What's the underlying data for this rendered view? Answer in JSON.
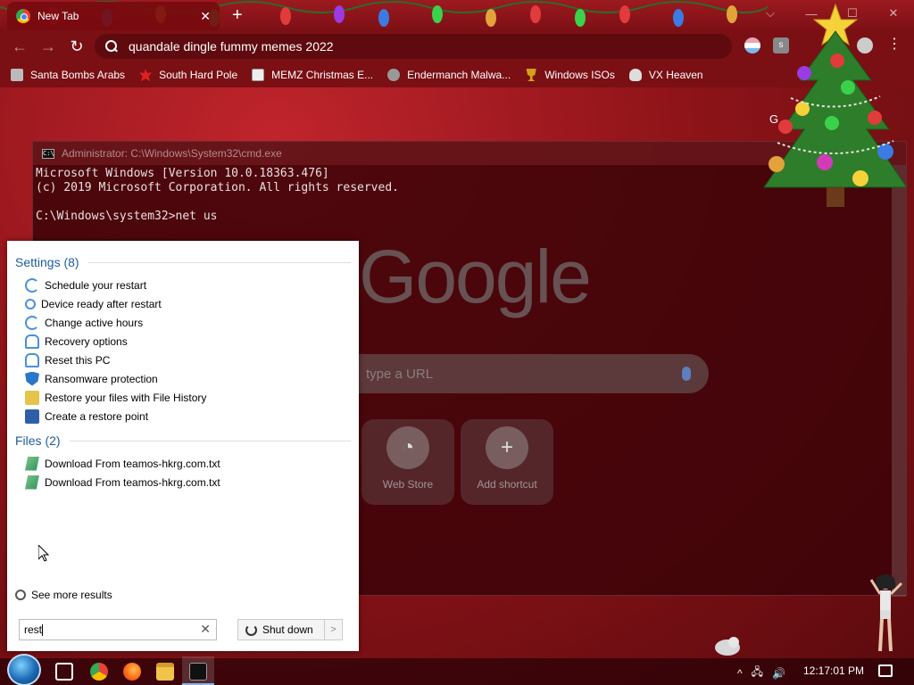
{
  "browser": {
    "tab_title": "New Tab",
    "tab_close": "✕",
    "new_tab": "+",
    "window_controls": {
      "chevron": "⌵",
      "minimize": "—",
      "maximize": "☐",
      "close": "✕"
    },
    "nav": {
      "back": "←",
      "forward": "→",
      "reload": "↻"
    },
    "omnibox_text": "quandale dingle fummy memes 2022",
    "extension_label": "s",
    "menu": "⋮",
    "bookmarks": [
      {
        "label": "Santa Bombs Arabs",
        "icon": "boot-icon"
      },
      {
        "label": "South Hard Pole",
        "icon": "maple-leaf-icon"
      },
      {
        "label": "MEMZ Christmas E...",
        "icon": "image-icon"
      },
      {
        "label": "Endermanch Malwa...",
        "icon": "raccoon-icon"
      },
      {
        "label": "Windows ISOs",
        "icon": "trophy-icon"
      },
      {
        "label": "VX Heaven",
        "icon": "skull-icon"
      }
    ],
    "apps_label": "G"
  },
  "cmd": {
    "title": "Administrator: C:\\Windows\\System32\\cmd.exe",
    "lines": "Microsoft Windows [Version 10.0.18363.476]\n(c) 2019 Microsoft Corporation. All rights reserved.\n\nC:\\Windows\\system32>net us"
  },
  "ntp": {
    "logo": "Google",
    "search_placeholder": "type a URL",
    "shortcuts": [
      {
        "label": "Web Store",
        "icon": "webstore-icon"
      },
      {
        "label": "Add shortcut",
        "icon": "plus-icon",
        "glyph": "+"
      }
    ]
  },
  "start_search": {
    "settings_header": "Settings (8)",
    "settings": [
      {
        "label": "Schedule your restart",
        "icon": "sync-icon"
      },
      {
        "label": "Device ready after restart",
        "icon": "magnifier-icon"
      },
      {
        "label": "Change active hours",
        "icon": "sync-icon"
      },
      {
        "label": "Recovery options",
        "icon": "person-icon"
      },
      {
        "label": "Reset this PC",
        "icon": "person-icon"
      },
      {
        "label": "Ransomware protection",
        "icon": "shield-icon"
      },
      {
        "label": "Restore your files with File History",
        "icon": "file-history-icon"
      },
      {
        "label": "Create a restore point",
        "icon": "restore-point-icon"
      }
    ],
    "files_header": "Files (2)",
    "files": [
      {
        "label": "Download From teamos-hkrg.com.txt",
        "icon": "notepad-icon"
      },
      {
        "label": "Download From teamos-hkrg.com.txt",
        "icon": "notepad-icon"
      }
    ],
    "see_more": "See more results",
    "query": "rest",
    "clear": "✕",
    "shutdown_label": "Shut down",
    "shutdown_arrow": ">"
  },
  "taskbar": {
    "clock": "12:17:01 PM",
    "tray_chevron": "^",
    "tray_network": "🖧",
    "tray_volume": "🔊"
  }
}
